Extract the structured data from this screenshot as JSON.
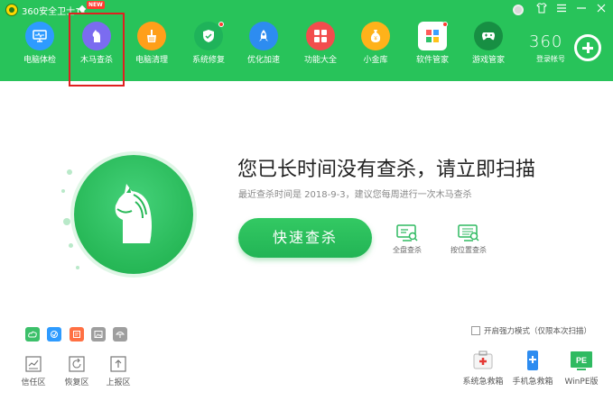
{
  "app": {
    "title": "360安全卫士11",
    "new_badge": "NEW"
  },
  "nav": [
    {
      "label": "电脑体检",
      "icon": "monitor-icon",
      "color": "#2e9bff"
    },
    {
      "label": "木马查杀",
      "icon": "horse-icon",
      "color": "#7b6cf0",
      "selected": true
    },
    {
      "label": "电脑清理",
      "icon": "broom-icon",
      "color": "#ff9f1a"
    },
    {
      "label": "系统修复",
      "icon": "shield-icon",
      "color": "#1fb35a",
      "dot": true
    },
    {
      "label": "优化加速",
      "icon": "rocket-icon",
      "color": "#2d8cf0"
    },
    {
      "label": "功能大全",
      "icon": "grid-icon",
      "color": "#f24d4d"
    },
    {
      "label": "小金库",
      "icon": "coin-bag-icon",
      "color": "#ffb21a"
    },
    {
      "label": "软件管家",
      "icon": "apps-icon",
      "color": "#ffffff",
      "dot": true
    },
    {
      "label": "游戏管家",
      "icon": "gamepad-icon",
      "color": "#20a84e"
    }
  ],
  "account": {
    "brand": "360",
    "login_label": "登录帐号"
  },
  "main": {
    "headline": "您已长时间没有查杀，请立即扫描",
    "last_scan": "最近查杀时间是 2018-9-3，建议您每周进行一次木马查杀",
    "quick_scan": "快速查杀",
    "full_scan": "全盘查杀",
    "custom_scan": "按位置查杀"
  },
  "bottom": {
    "trust": "信任区",
    "restore": "恢复区",
    "report": "上报区",
    "force_mode": "开启强力模式（仅限本次扫描）",
    "system_rescue": "系统急救箱",
    "mobile_rescue": "手机急救箱",
    "winpe": "WinPE版",
    "pe_badge": "PE"
  },
  "colors": {
    "brand_green": "#28c35a",
    "selection_red": "#e02020"
  }
}
